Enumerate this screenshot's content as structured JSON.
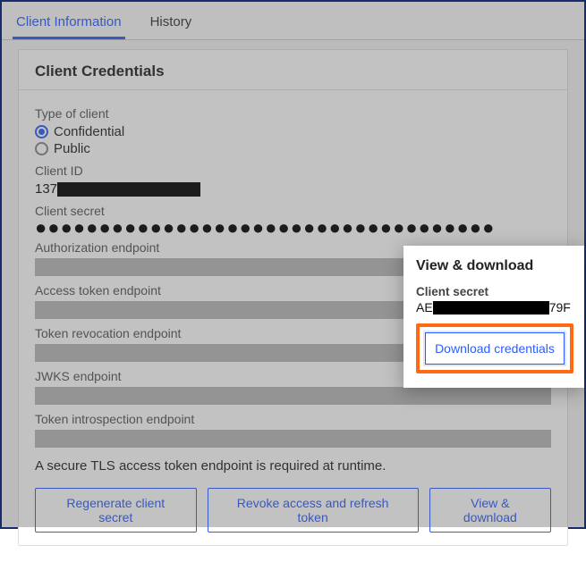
{
  "tabs": {
    "client_info": "Client Information",
    "history": "History"
  },
  "section_title": "Client Credentials",
  "fields": {
    "type_of_client_label": "Type of client",
    "radio_confidential": "Confidential",
    "radio_public": "Public",
    "client_id_label": "Client ID",
    "client_id_prefix": "137",
    "client_secret_label": "Client secret",
    "client_secret_dots": "●●●●●●●●●●●●●●●●●●●●●●●●●●●●●●●●●●●●",
    "auth_endpoint_label": "Authorization endpoint",
    "access_token_endpoint_label": "Access token endpoint",
    "token_revocation_endpoint_label": "Token revocation endpoint",
    "jwks_endpoint_label": "JWKS endpoint",
    "token_introspection_endpoint_label": "Token introspection endpoint"
  },
  "note": "A secure TLS access token endpoint is required at runtime.",
  "buttons": {
    "regenerate": "Regenerate client secret",
    "revoke": "Revoke access and refresh token",
    "view_download": "View & download"
  },
  "popup": {
    "title": "View & download",
    "secret_label": "Client secret",
    "secret_prefix": "AE",
    "secret_suffix": "79F",
    "download_btn": "Download credentials"
  }
}
